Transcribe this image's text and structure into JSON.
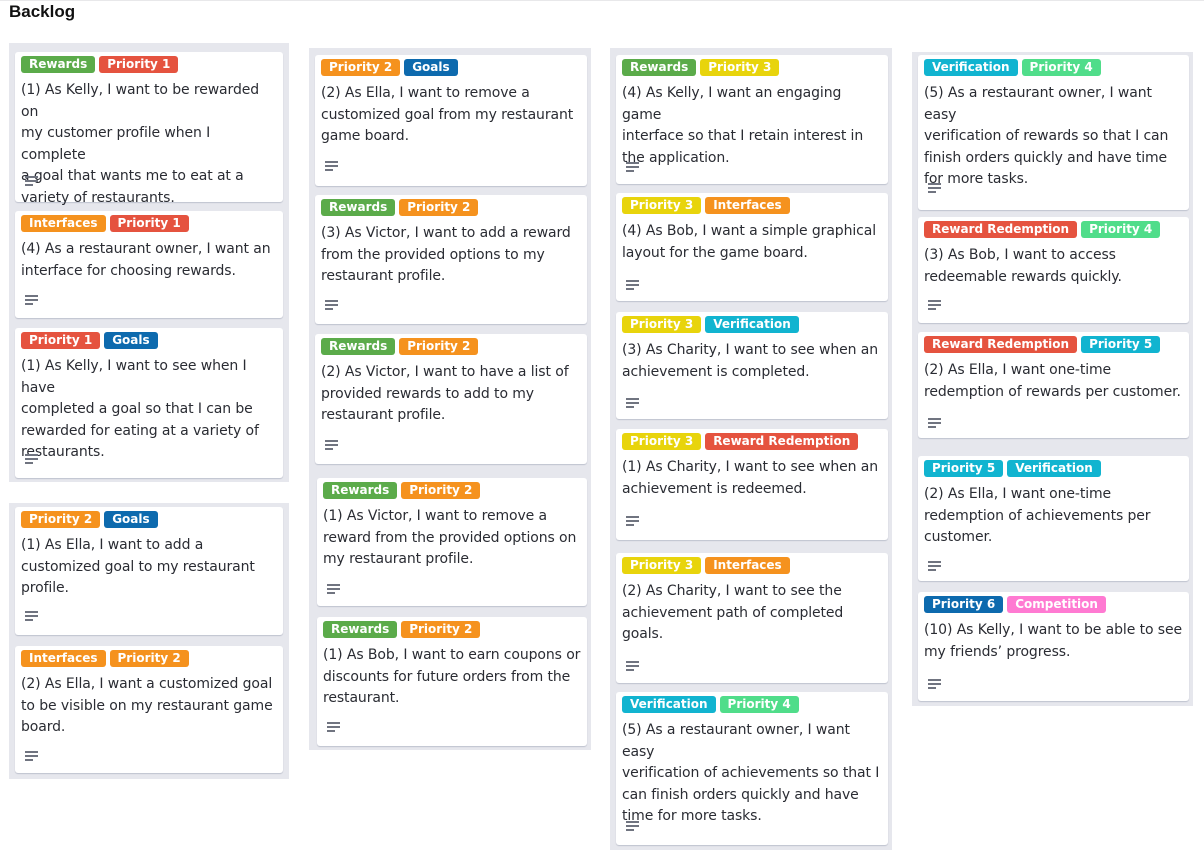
{
  "board": {
    "title": "Backlog"
  },
  "colors": {
    "Rewards": "#5bab4a",
    "Interfaces": "#f5921e",
    "Goals": "#0d6aae",
    "Verification": "#11b4d0",
    "Reward Redemption": "#e5533f",
    "Competition": "#ff7ad2",
    "Priority 1": "#e5533f",
    "Priority 2": "#f5921e",
    "Priority 3": "#e8d40c",
    "Priority 4": "#50dd8a",
    "Priority 5": "#11b4d0",
    "Priority 6": "#0d6aae"
  },
  "cards": [
    {
      "labels": [
        "Rewards",
        "Priority 1"
      ],
      "text": "(1) As Kelly, I want to be rewarded on\nmy customer profile when I complete\na goal that wants me to eat at a\nvariety of restaurants."
    },
    {
      "labels": [
        "Interfaces",
        "Priority 1"
      ],
      "text": "(4) As a restaurant owner, I want an\ninterface for choosing rewards."
    },
    {
      "labels": [
        "Priority 1",
        "Goals"
      ],
      "text": "(1) As Kelly, I want to see when I have\ncompleted a goal so that I can be\nrewarded for eating at a variety of\nrestaurants."
    },
    {
      "labels": [
        "Priority 2",
        "Goals"
      ],
      "text": "(1) As Ella, I want to add a\ncustomized goal to my restaurant\nprofile."
    },
    {
      "labels": [
        "Interfaces",
        "Priority 2"
      ],
      "text": "(2) As Ella, I want a customized goal\nto be visible on my restaurant game\nboard."
    },
    {
      "labels": [
        "Priority 2",
        "Goals"
      ],
      "text": "(2) As Ella, I want to remove a\ncustomized goal from my restaurant\ngame board."
    },
    {
      "labels": [
        "Rewards",
        "Priority 2"
      ],
      "text": "(3) As Victor, I want to add a reward\nfrom the provided options to my\nrestaurant profile."
    },
    {
      "labels": [
        "Rewards",
        "Priority 2"
      ],
      "text": "(2) As Victor, I want to have a list of\nprovided rewards to add to my\nrestaurant profile."
    },
    {
      "labels": [
        "Rewards",
        "Priority 2"
      ],
      "text": "(1) As Victor, I want to remove a\nreward from the provided options on\nmy restaurant profile."
    },
    {
      "labels": [
        "Rewards",
        "Priority 2"
      ],
      "text": "(1) As Bob, I want to earn coupons or\ndiscounts for future orders from the\nrestaurant."
    },
    {
      "labels": [
        "Rewards",
        "Priority 3"
      ],
      "text": "(4) As Kelly, I want an engaging game\ninterface so that I retain interest in\nthe application."
    },
    {
      "labels": [
        "Priority 3",
        "Interfaces"
      ],
      "text": "(4) As Bob, I want a simple graphical\nlayout for the game board."
    },
    {
      "labels": [
        "Priority 3",
        "Verification"
      ],
      "text": "(3) As Charity, I want to see when an\nachievement is completed."
    },
    {
      "labels": [
        "Priority 3",
        "Reward Redemption"
      ],
      "text": "(1) As Charity, I want to see when an\nachievement is redeemed."
    },
    {
      "labels": [
        "Priority 3",
        "Interfaces"
      ],
      "text": "(2) As Charity, I want to see the\nachievement path of completed\ngoals."
    },
    {
      "labels": [
        "Verification",
        "Priority 4"
      ],
      "text": "(5) As a restaurant owner, I want easy\nverification of achievements so that I\ncan finish orders quickly and have\ntime for more tasks."
    },
    {
      "labels": [
        "Verification",
        "Priority 4"
      ],
      "text": "(5) As a restaurant owner, I want easy\nverification of rewards so that I can\nfinish orders quickly and have time\nfor more tasks."
    },
    {
      "labels": [
        "Reward Redemption",
        "Priority 4"
      ],
      "text": "(3) As Bob, I want to access\nredeemable rewards quickly."
    },
    {
      "labels": [
        "Reward Redemption",
        "Priority 5"
      ],
      "text": "(2) As Ella, I want one-time\nredemption of rewards per customer."
    },
    {
      "labels": [
        "Priority 5",
        "Verification"
      ],
      "text": "(2) As Ella, I want one-time\nredemption of achievements per\ncustomer."
    },
    {
      "labels": [
        "Priority 6",
        "Competition"
      ],
      "text": "(10) As Kelly, I want to be able to see\nmy friends’ progress."
    }
  ]
}
